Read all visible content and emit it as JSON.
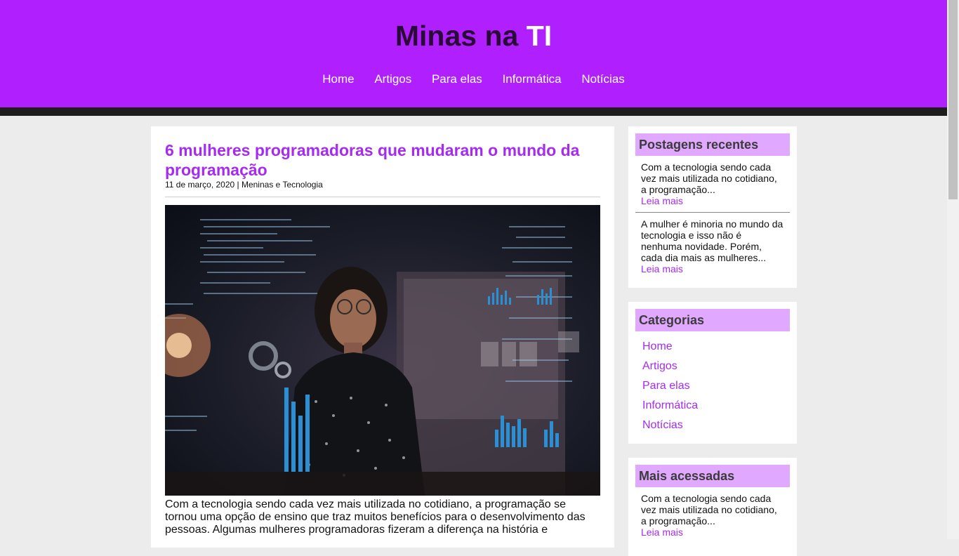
{
  "header": {
    "title_prefix": "Minas na ",
    "title_accent": "TI",
    "nav": [
      "Home",
      "Artigos",
      "Para elas",
      "Informática",
      "Notícias"
    ]
  },
  "post": {
    "title": "6 mulheres programadoras que mudaram o mundo da programação",
    "meta": "11 de março, 2020 | Meninas e Tecnologia",
    "excerpt": "Com a tecnologia sendo cada vez mais utilizada no cotidiano, a programação se tornou uma opção de ensino que traz muitos benefícios para o desenvolvimento das pessoas. Algumas mulheres programadoras fizeram a diferença na história e"
  },
  "sidebar": {
    "recent": {
      "heading": "Postagens recentes",
      "items": [
        {
          "text": "Com a tecnologia sendo cada vez mais utilizada no cotidiano, a programação...",
          "link": "Leia mais"
        },
        {
          "text": "A mulher é minoria no mundo da tecnologia e isso não é nenhuma novidade. Porém, cada dia mais as mulheres...",
          "link": "Leia mais"
        }
      ]
    },
    "categories": {
      "heading": "Categorias",
      "items": [
        "Home",
        "Artigos",
        "Para elas",
        "Informática",
        "Notícias"
      ]
    },
    "popular": {
      "heading": "Mais acessadas",
      "items": [
        {
          "text": "Com a tecnologia sendo cada vez mais utilizada no cotidiano, a programação...",
          "link": "Leia mais"
        }
      ]
    }
  },
  "colors": {
    "header": "#b020ff",
    "accent": "#a62bf0",
    "sidebar_head": "#e0a8ff"
  }
}
